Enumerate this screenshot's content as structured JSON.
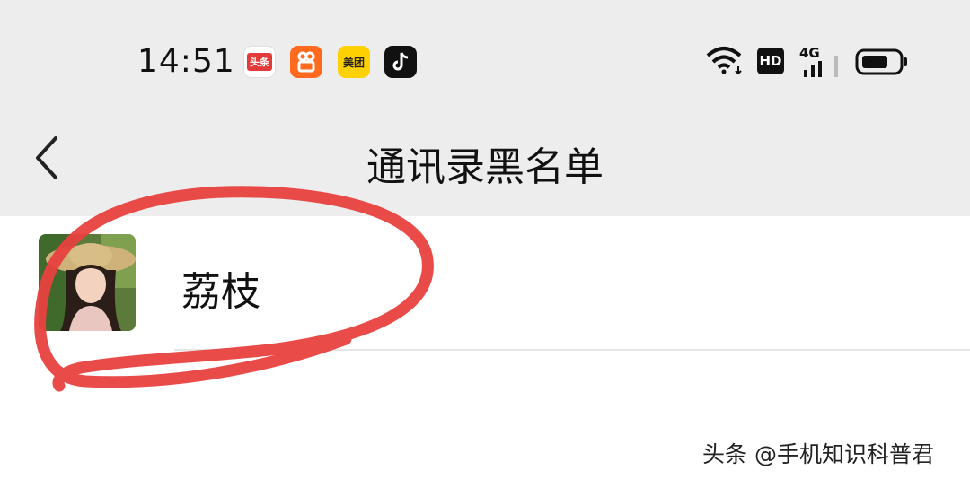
{
  "status_bar": {
    "time": "14:51",
    "apps": [
      {
        "name": "toutiao-app-icon",
        "text": "头条"
      },
      {
        "name": "kuaishou-app-icon",
        "text": ""
      },
      {
        "name": "meituan-app-icon",
        "text": "美团"
      },
      {
        "name": "douyin-app-icon",
        "text": ""
      }
    ],
    "hd": "HD",
    "network": "4G"
  },
  "nav": {
    "title": "通讯录黑名单"
  },
  "blacklist": {
    "items": [
      {
        "name": "荔枝"
      }
    ]
  },
  "annotation_color": "#e8413f",
  "watermark": "头条 @手机知识科普君"
}
